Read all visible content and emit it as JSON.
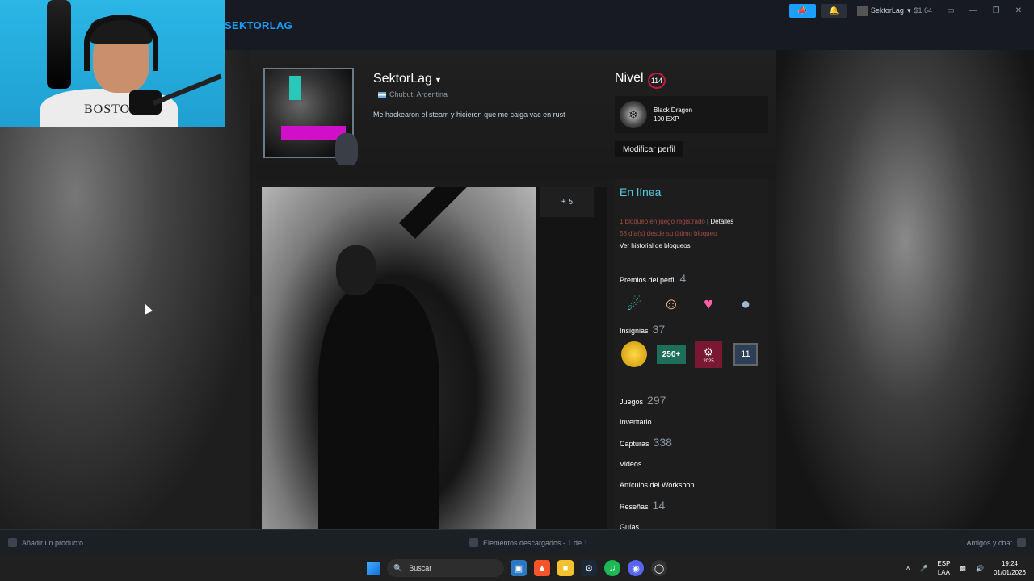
{
  "webcam": {
    "shirt_text": "BOSTOI"
  },
  "header": {
    "steam_name": "SEKTORLAG"
  },
  "topbar": {
    "username": "SektorLag",
    "balance": "$1.64"
  },
  "profile": {
    "username": "SektorLag",
    "location": "Chubut, Argentina",
    "summary": "Me hackearon el steam y hicieron que me caiga vac en rust",
    "level_label": "Nivel",
    "level": "114",
    "badge_name": "Black Dragon",
    "badge_exp": "100 EXP",
    "edit_button": "Modificar perfil",
    "showcase_more": "+ 5"
  },
  "sidebar": {
    "status": "En línea",
    "ban_text": "1 bloqueo en juego registrado",
    "ban_sep": " | ",
    "ban_details": "Detalles",
    "ban_days": "58 día(s) desde su último bloqueo",
    "ban_history": "Ver historial de bloqueos",
    "awards_label": "Premios del perfil",
    "awards_count": "4",
    "badges_label": "Insignias",
    "badges_count": "37",
    "games_label": "Juegos",
    "games_count": "297",
    "inventory_label": "Inventario",
    "screenshots_label": "Capturas",
    "screenshots_count": "338",
    "videos_label": "Videos",
    "workshop_label": "Artículos del Workshop",
    "reviews_label": "Reseñas",
    "reviews_count": "14",
    "guides_label": "Guías",
    "badge_250": "250+",
    "badge_year": "2025",
    "badge_11": "11"
  },
  "footer": {
    "add_product": "Añadir un producto",
    "downloads": "Elementos descargados - 1 de 1",
    "friends": "Amigos y chat"
  },
  "taskbar": {
    "search_placeholder": "Buscar",
    "lang_top": "ESP",
    "lang_bottom": "LAA",
    "time": "19:24",
    "date": "01/01/2026"
  },
  "colors": {
    "accent": "#1a9fff",
    "online": "#57cbde",
    "ban": "#a34c46",
    "level_ring": "#c41a3f"
  }
}
